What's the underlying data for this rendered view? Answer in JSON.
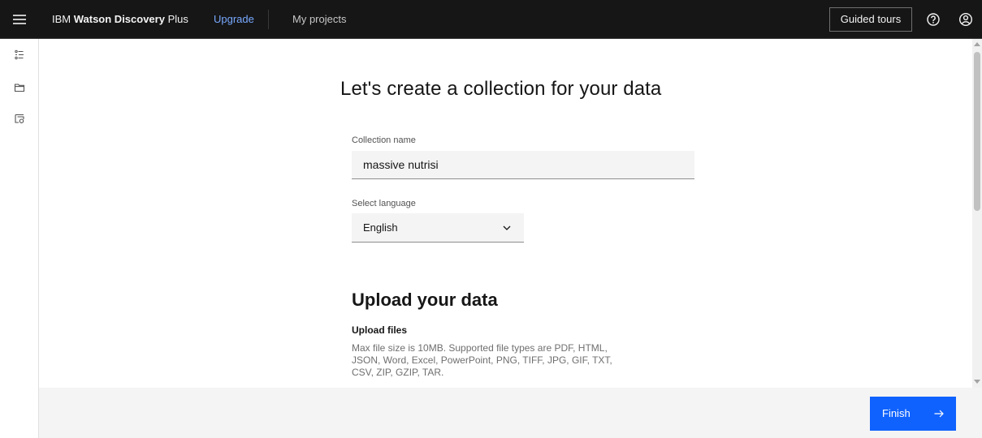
{
  "header": {
    "brand_prefix": "IBM ",
    "brand_bold": "Watson Discovery",
    "brand_suffix": " Plus",
    "upgrade_label": "Upgrade",
    "my_projects_label": "My projects",
    "guided_tours_label": "Guided tours",
    "icons": [
      "menu-icon",
      "help-icon",
      "user-profile-icon"
    ]
  },
  "rail": {
    "icons": [
      "manage-data-icon",
      "folder-icon",
      "data-structure-icon"
    ]
  },
  "main": {
    "title": "Let's create a collection for your data",
    "collection_name": {
      "label": "Collection name",
      "value": "massive nutrisi"
    },
    "language": {
      "label": "Select language",
      "selected": "English"
    },
    "upload": {
      "title": "Upload your data",
      "subheading": "Upload files",
      "help": "Max file size is 10MB. Supported file types are PDF, HTML, JSON, Word, Excel, PowerPoint, PNG, TIFF, JPG, GIF, TXT, CSV, ZIP, GZIP, TAR."
    }
  },
  "footer": {
    "finish_label": "Finish"
  },
  "colors": {
    "header_bg": "#161616",
    "primary_button": "#0f62fe",
    "link": "#78a9ff",
    "field_bg": "#f4f4f4"
  }
}
